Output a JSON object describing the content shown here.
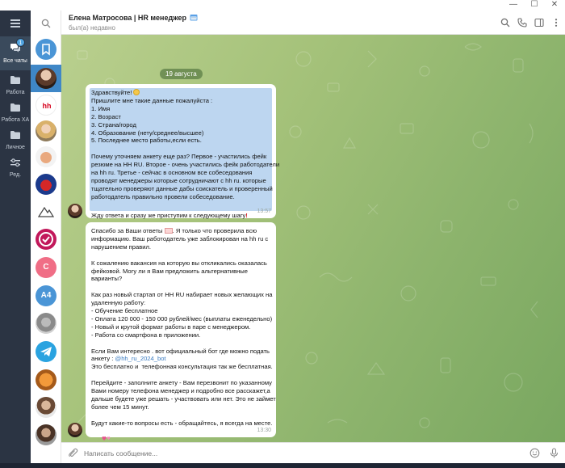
{
  "window": {
    "controls": [
      "—",
      "☐",
      "✕"
    ]
  },
  "folders": [
    {
      "label": "Все чаты",
      "badge": "1",
      "icon": "chat-bubbles-icon",
      "active": true
    },
    {
      "label": "Работа",
      "icon": "folder-icon"
    },
    {
      "label": "Работа ХА",
      "icon": "folder-icon"
    },
    {
      "label": "Личное",
      "icon": "folder-icon"
    },
    {
      "label": "Ред.",
      "icon": "edit-sliders-icon"
    }
  ],
  "header": {
    "title": "Елена Матросова | HR менеджер",
    "status": "был(а) недавно",
    "title_emoji": "calendar-emoji"
  },
  "chat": {
    "date": "19 августа",
    "message1": {
      "lines": [
        "Здравствуйте!",
        "Пришлите мне такие данные пожалуйста :",
        "1. Имя",
        "2. Возраст",
        "3. Страна/город",
        "4. Образование (нету/среднее/высшее)",
        "5. Последнее место работы,если есть.",
        "",
        "Почему уточняем анкету еще раз? Первое - участились фейк",
        "резюме на HH RU. Второе - очень участились фейк работодатели",
        "на hh ru. Третье - сейчас в основном все собеседования",
        "проводят менеджеры которые сотрудничают с hh ru. которые",
        "тщательно проверяют данные дабы соискатель и проверенный",
        "работодатель правильно провели собеседование.",
        ""
      ],
      "last_line": "Жду ответа и сразу же приступим к следующему шагу",
      "time": "13:57"
    },
    "message2": {
      "line1": "Спасибо за Ваши ответы",
      "line1_tail": ". Я только что проверила всю",
      "lines_a": [
        "информацию. Ваш работодатель уже заблокирован на hh ru с",
        "нарушением правил.",
        "",
        "К сожалению вакансия на которую вы откликались оказалась",
        "фейковой. Могу ли я Вам предложить альтернативные",
        "варианты?",
        "",
        "Как раз новый стартап от HH RU набирает новых желающих на",
        "удаленную работу:",
        "- Обучение бесплатное",
        "- Оплата 120 000 - 150 000 рублей/мес (выплаты еженедельно)",
        "- Новый и крутой формат работы в паре с менеджером.",
        "- Работа со смартфона в приложении.",
        "",
        "Если Вам интересно . вот официальный бот где можно подать"
      ],
      "bot_prefix": "анкету : ",
      "bot_link": "@hh_ru_2024_bot",
      "lines_b": [
        "Это бесплатно и  телефонная консультация так же бесплатная.",
        "",
        "Перейдите - заполните анкету - Вам перезвонит по указанному",
        "Вами номеру телефона менеджер и подробно все расскажет,а",
        "дальше будете уже решать - участвовать или нет. Это не займет",
        "более чем 15 минут.",
        "",
        "Будут какие-то вопросы есть - обращайтесь, я всегда на месте."
      ],
      "time": "13:30"
    }
  },
  "composer": {
    "placeholder": "Написать сообщение..."
  },
  "colors": {
    "rail": "#2b3443",
    "accent": "#4fa3e0",
    "selection": "#bdd6f0",
    "link": "#3a7bc0"
  }
}
